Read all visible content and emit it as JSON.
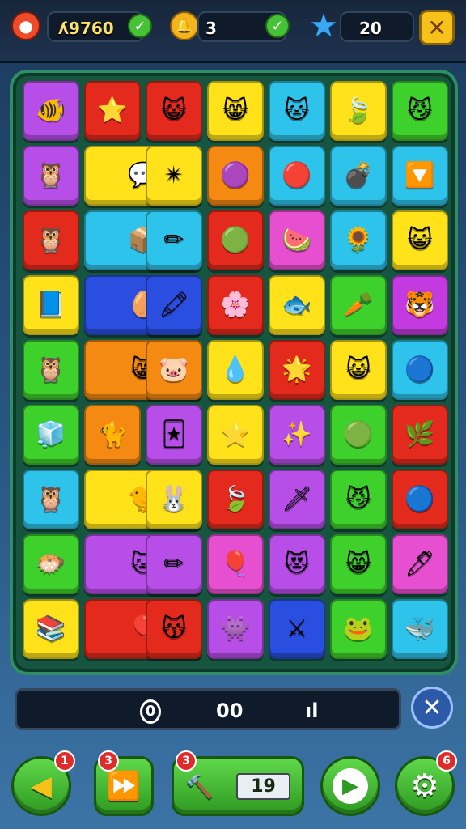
{
  "hud": {
    "lives_icon": "red-balloon-icon",
    "score": "ʎ9760",
    "coins_icon": "gold-bell-icon",
    "coins": "3",
    "stars_icon": "blue-star-icon",
    "stars": "20",
    "close_icon": "close-icon"
  },
  "colors": {
    "purple": "#b84ee8",
    "red": "#e42a1c",
    "yellow": "#ffe21a",
    "cyan": "#2ec3ea",
    "green": "#3fd12b",
    "orange": "#f58a12",
    "blue": "#2a4fe0",
    "pink": "#e64fd0",
    "magenta": "#c33ae0"
  },
  "board": {
    "rows": [
      [
        {
          "color": "purple",
          "icon": "orange-fish-icon",
          "glyph": "🐠"
        },
        {
          "color": "red",
          "icon": "blue-star-icon",
          "glyph": "⭐"
        },
        {
          "color": "red",
          "icon": "pink-cat-icon",
          "glyph": "😺"
        },
        {
          "color": "yellow",
          "icon": "orange-cat-icon",
          "glyph": "😸"
        },
        {
          "color": "cyan",
          "icon": "green-cat-icon",
          "glyph": "🐱"
        },
        {
          "color": "yellow",
          "icon": "purple-leaf-icon",
          "glyph": "🍃"
        },
        {
          "color": "green",
          "icon": "orange-cat-icon",
          "glyph": "😼"
        }
      ],
      [
        {
          "color": "purple",
          "icon": "brown-owl-icon",
          "glyph": "🦉"
        },
        {
          "color": "yellow",
          "icon": "blue-bubble-icon",
          "glyph": "💬",
          "span": 2
        },
        {
          "color": "yellow",
          "icon": "bird-star-icon",
          "glyph": "✴"
        },
        {
          "color": "orange",
          "icon": "purple-blob-icon",
          "glyph": "🟣"
        },
        {
          "color": "cyan",
          "icon": "red-ball-icon",
          "glyph": "🔴"
        },
        {
          "color": "cyan",
          "icon": "red-bomb-icon",
          "glyph": "💣"
        },
        {
          "color": "cyan",
          "icon": "arrow-flag-icon",
          "glyph": "🔽"
        }
      ],
      [
        {
          "color": "red",
          "icon": "brown-owl-icon",
          "glyph": "🦉"
        },
        {
          "color": "cyan",
          "icon": "box-pencil-icon",
          "glyph": "📦",
          "span": 2
        },
        {
          "color": "cyan",
          "icon": "pencil-icon",
          "glyph": "✏"
        },
        {
          "color": "red",
          "icon": "green-smile-icon",
          "glyph": "🟢"
        },
        {
          "color": "pink",
          "icon": "watermelon-icon",
          "glyph": "🍉"
        },
        {
          "color": "cyan",
          "icon": "sun-flower-icon",
          "glyph": "🌻"
        },
        {
          "color": "yellow",
          "icon": "orange-cat-icon",
          "glyph": "😺"
        }
      ],
      [
        {
          "color": "yellow",
          "icon": "blue-book-icon",
          "glyph": "📘"
        },
        {
          "color": "blue",
          "icon": "egg-pencil-icon",
          "glyph": "🥚",
          "span": 2
        },
        {
          "color": "blue",
          "icon": "pencil-icon",
          "glyph": "🖍"
        },
        {
          "color": "red",
          "icon": "pink-flower-icon",
          "glyph": "🌸"
        },
        {
          "color": "yellow",
          "icon": "green-fish-icon",
          "glyph": "🐟"
        },
        {
          "color": "green",
          "icon": "orange-carrot-icon",
          "glyph": "🥕"
        },
        {
          "color": "magenta",
          "icon": "yellow-cat-icon",
          "glyph": "🐯"
        }
      ],
      [
        {
          "color": "green",
          "icon": "owl-face-icon",
          "glyph": "🦉"
        },
        {
          "color": "orange",
          "icon": "orange-cat-icon",
          "glyph": "😸",
          "span": 2
        },
        {
          "color": "orange",
          "icon": "pink-pig-icon",
          "glyph": "🐷"
        },
        {
          "color": "yellow",
          "icon": "blue-drop-icon",
          "glyph": "💧"
        },
        {
          "color": "red",
          "icon": "orange-star-icon",
          "glyph": "🌟"
        },
        {
          "color": "yellow",
          "icon": "yellow-cat-icon",
          "glyph": "😺"
        },
        {
          "color": "cyan",
          "icon": "blue-drop-icon",
          "glyph": "🔵"
        }
      ],
      [
        {
          "color": "green",
          "icon": "cube-box-icon",
          "glyph": "🧊"
        },
        {
          "color": "orange",
          "icon": "cat-silhouette-icon",
          "glyph": "🐈"
        },
        {
          "color": "purple",
          "icon": "card-icon",
          "glyph": "🃏"
        },
        {
          "color": "yellow",
          "icon": "yellow-star-icon",
          "glyph": "⭐"
        },
        {
          "color": "purple",
          "icon": "orange-star-icon",
          "glyph": "✨"
        },
        {
          "color": "green",
          "icon": "green-bubble-icon",
          "glyph": "🟢"
        },
        {
          "color": "red",
          "icon": "green-leaf-icon",
          "glyph": "🌿"
        }
      ],
      [
        {
          "color": "cyan",
          "icon": "brown-owl-icon",
          "glyph": "🦉"
        },
        {
          "color": "yellow",
          "icon": "yellow-bird-icon",
          "glyph": "🐤",
          "span": 2
        },
        {
          "color": "yellow",
          "icon": "pink-cat-icon",
          "glyph": "🐰"
        },
        {
          "color": "red",
          "icon": "green-leaf-icon",
          "glyph": "🍃"
        },
        {
          "color": "purple",
          "icon": "sword-icon",
          "glyph": "🗡"
        },
        {
          "color": "green",
          "icon": "orange-cat-icon",
          "glyph": "😼"
        },
        {
          "color": "red",
          "icon": "blue-ball-icon",
          "glyph": "🔵"
        }
      ],
      [
        {
          "color": "green",
          "icon": "orange-fish-icon",
          "glyph": "🐡"
        },
        {
          "color": "purple",
          "icon": "blue-cat-icon",
          "glyph": "🐱",
          "span": 2
        },
        {
          "color": "purple",
          "icon": "pencil-icon",
          "glyph": "✏"
        },
        {
          "color": "pink",
          "icon": "red-ball-icon",
          "glyph": "🎈"
        },
        {
          "color": "purple",
          "icon": "yellow-cat-icon",
          "glyph": "😻"
        },
        {
          "color": "green",
          "icon": "orange-cat-icon",
          "glyph": "😸"
        },
        {
          "color": "pink",
          "icon": "pencil-icon",
          "glyph": "🖊"
        }
      ],
      [
        {
          "color": "yellow",
          "icon": "blue-book-icon",
          "glyph": "📚"
        },
        {
          "color": "red",
          "icon": "red-balloon-icon",
          "glyph": "🎈",
          "span": 2
        },
        {
          "color": "red",
          "icon": "pink-cat-icon",
          "glyph": "😽"
        },
        {
          "color": "purple",
          "icon": "purple-blob-icon",
          "glyph": "👾"
        },
        {
          "color": "blue",
          "icon": "sword-icon",
          "glyph": "⚔"
        },
        {
          "color": "green",
          "icon": "green-cat-icon",
          "glyph": "🐸"
        },
        {
          "color": "cyan",
          "icon": "blue-cat-icon",
          "glyph": "🐳"
        }
      ]
    ]
  },
  "progress": {
    "left_icon": "coin-icon",
    "left_glyph": "0",
    "value": "00",
    "right_icon": "pause-icon",
    "right_glyph": "ıl",
    "close_icon": "close-icon",
    "close_glyph": "✕"
  },
  "controls": [
    {
      "name": "undo-button",
      "icon": "left-arrow-icon",
      "glyph": "◀",
      "badge": "1"
    },
    {
      "name": "fast-forward-button",
      "icon": "fast-forward-icon",
      "glyph": "⏩",
      "badge": "3"
    },
    {
      "name": "hammer-button",
      "icon": "hammer-icon",
      "glyph": "🔨",
      "label": "19",
      "badge": "3"
    },
    {
      "name": "play-button",
      "icon": "play-icon",
      "glyph": "▶"
    },
    {
      "name": "settings-button",
      "icon": "gear-icon",
      "glyph": "⚙",
      "badge": "6"
    }
  ]
}
